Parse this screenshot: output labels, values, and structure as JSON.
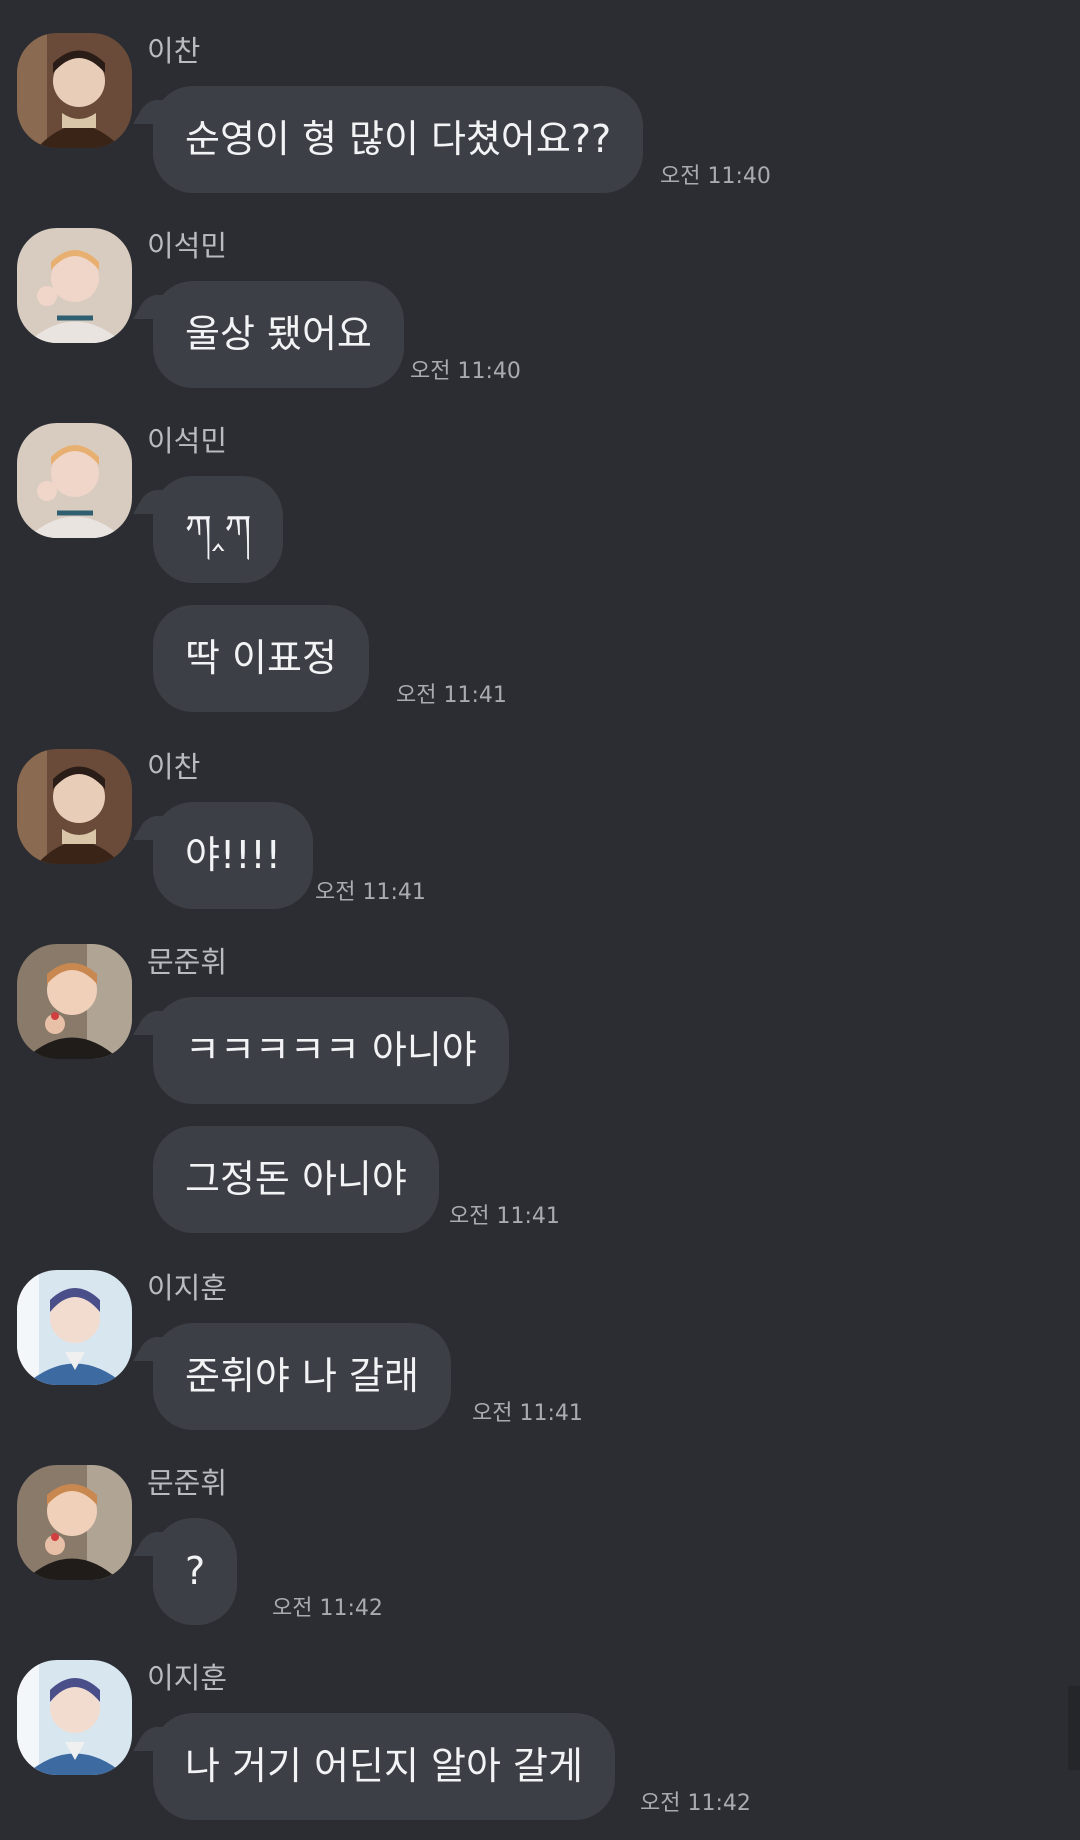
{
  "messages": [
    {
      "sender": "이찬",
      "avatar": "chan-avatar-icon",
      "bubbles": [
        "순영이 형 많이 다쳤어요??"
      ],
      "time": "오전 11:40"
    },
    {
      "sender": "이석민",
      "avatar": "seokmin-avatar-icon",
      "bubbles": [
        "울상 됐어요"
      ],
      "time": "오전 11:40"
    },
    {
      "sender": "이석민",
      "avatar": "seokmin-avatar-icon",
      "bubbles": [
        "ཀ‸ཀ",
        "딱 이표정"
      ],
      "time": "오전 11:41"
    },
    {
      "sender": "이찬",
      "avatar": "chan-avatar-icon",
      "bubbles": [
        "야!!!!"
      ],
      "time": "오전 11:41"
    },
    {
      "sender": "문준휘",
      "avatar": "junhui-avatar-icon",
      "bubbles": [
        "ㅋㅋㅋㅋㅋ 아니야",
        "그정돈 아니야"
      ],
      "time": "오전 11:41"
    },
    {
      "sender": "이지훈",
      "avatar": "jihoon-avatar-icon",
      "bubbles": [
        "준휘야 나 갈래"
      ],
      "time": "오전 11:41"
    },
    {
      "sender": "문준휘",
      "avatar": "junhui-avatar-icon",
      "bubbles": [
        "?"
      ],
      "time": "오전 11:42"
    },
    {
      "sender": "이지훈",
      "avatar": "jihoon-avatar-icon",
      "bubbles": [
        "나 거기 어딘지 알아 갈게"
      ],
      "time": "오전 11:42"
    }
  ],
  "colors": {
    "background": "#2b2d32",
    "bubble": "#3c3f45",
    "sender_text": "#b9bbc0",
    "time_text": "#a9abb1"
  }
}
